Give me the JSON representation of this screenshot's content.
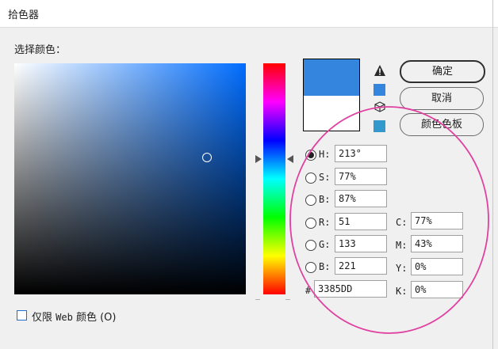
{
  "window": {
    "title": "拾色器"
  },
  "picker": {
    "select_label": "选择颜色："
  },
  "preview": {
    "new_color": "#3385dd",
    "current_color": "#ffffff"
  },
  "buttons": {
    "ok": "确定",
    "cancel": "取消",
    "swatches": "颜色色板"
  },
  "icons": {
    "gamut_warning": "warning-triangle-icon",
    "web_safe": "cube-icon"
  },
  "fields": {
    "H": {
      "label": "H:",
      "value": "213°",
      "selected": true
    },
    "S": {
      "label": "S:",
      "value": "77%"
    },
    "B": {
      "label": "B:",
      "value": "87%"
    },
    "R": {
      "label": "R:",
      "value": "51"
    },
    "G": {
      "label": "G:",
      "value": "133"
    },
    "B2": {
      "label": "B:",
      "value": "221"
    },
    "hex": {
      "label": "#",
      "value": "3385DD"
    },
    "C": {
      "label": "C:",
      "value": "77%"
    },
    "M": {
      "label": "M:",
      "value": "43%"
    },
    "Y": {
      "label": "Y:",
      "value": "0%"
    },
    "K": {
      "label": "K:",
      "value": "0%"
    }
  },
  "web_only": {
    "label_prefix": "仅限 ",
    "label_web": "Web",
    "label_suffix": " 颜色 (O)",
    "checked": false
  },
  "annotation": {
    "ring_color": "#e040a0"
  }
}
